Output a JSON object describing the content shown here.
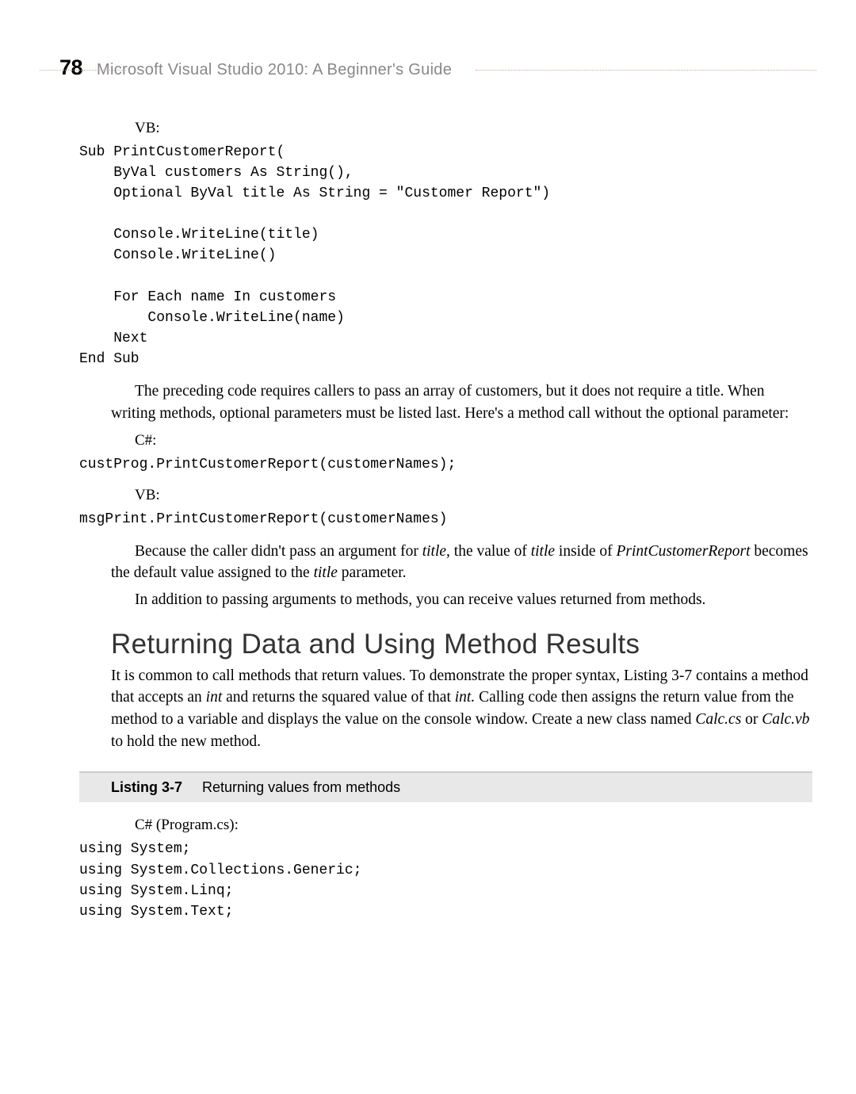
{
  "header": {
    "page_number": "78",
    "book_title": "Microsoft Visual Studio 2010: A Beginner's Guide"
  },
  "lang": {
    "vb": "VB:",
    "csharp": "C#:",
    "csharp_file": "C# (Program.cs):"
  },
  "code": {
    "vb_sub": "Sub PrintCustomerReport(\n    ByVal customers As String(),\n    Optional ByVal title As String = \"Customer Report\")\n\n    Console.WriteLine(title)\n    Console.WriteLine()\n\n    For Each name In customers\n        Console.WriteLine(name)\n    Next\nEnd Sub",
    "cs_call": "custProg.PrintCustomerReport(customerNames);",
    "vb_call": "msgPrint.PrintCustomerReport(customerNames)",
    "cs_using": "using System;\nusing System.Collections.Generic;\nusing System.Linq;\nusing System.Text;"
  },
  "para": {
    "p1": "The preceding code requires callers to pass an array of customers, but it does not require a title. When writing methods, optional parameters must be listed last. Here's a method call without the optional parameter:",
    "p2a": "Because the caller didn't pass an argument for ",
    "p2b": "title,",
    "p2c": " the value of ",
    "p2d": "title",
    "p2e": " inside of ",
    "p2f": "PrintCustomerReport",
    "p2g": " becomes the default value assigned to the ",
    "p2h": "title",
    "p2i": " parameter.",
    "p3": "In addition to passing arguments to methods, you can receive values returned from methods.",
    "p4a": "It is common to call methods that return values. To demonstrate the proper syntax, Listing 3-7 contains a method that accepts an ",
    "p4b": "int",
    "p4c": " and returns the squared value of that ",
    "p4d": "int.",
    "p4e": " Calling code then assigns the return value from the method to a variable and displays the value on the console window. Create a new class named ",
    "p4f": "Calc.cs",
    "p4g": " or ",
    "p4h": "Calc.vb",
    "p4i": " to hold the new method."
  },
  "heading": {
    "returning": "Returning Data and Using Method Results"
  },
  "listing": {
    "num": "Listing 3-7",
    "caption": "Returning values from methods"
  }
}
